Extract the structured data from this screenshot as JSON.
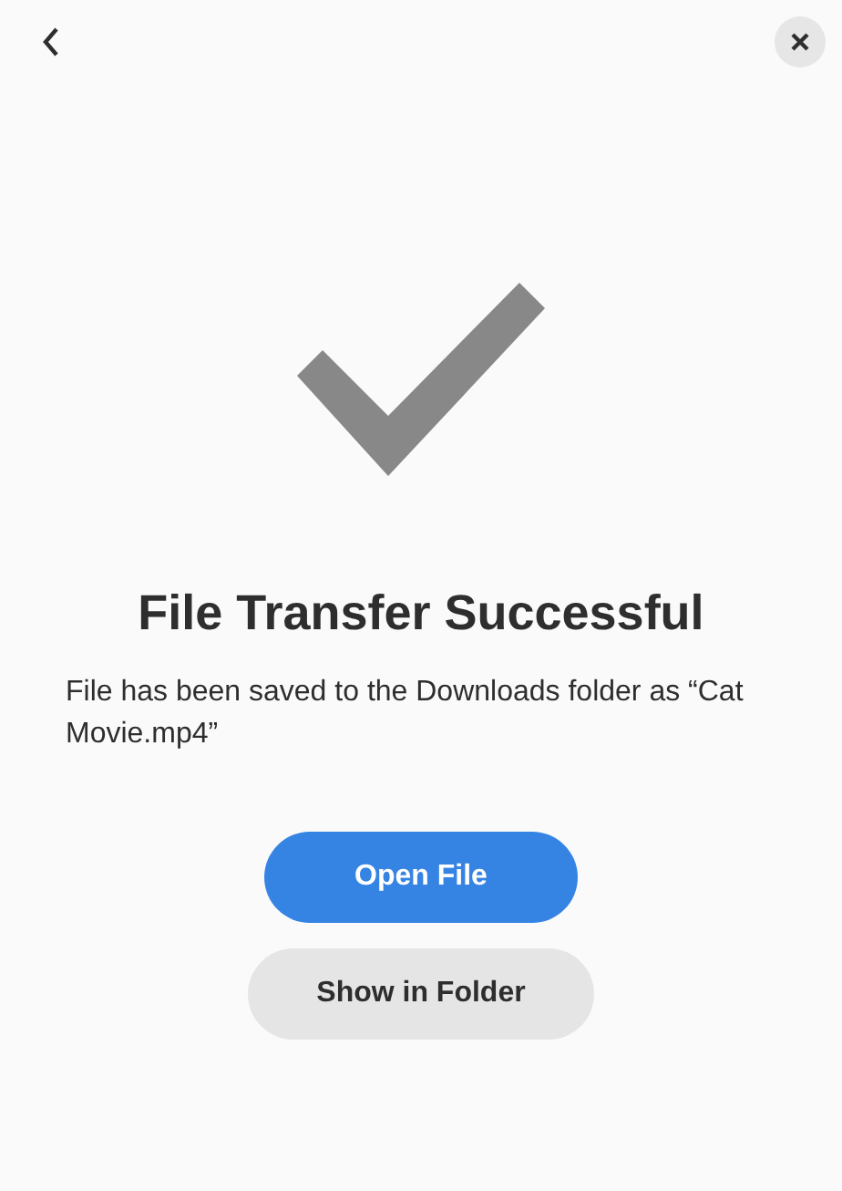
{
  "title": "File Transfer Successful",
  "message": "File has been saved to the Downloads folder as “Cat Movie.mp4”",
  "buttons": [
    {
      "label": "Open File",
      "kind": "primary"
    },
    {
      "label": "Show in Folder",
      "kind": "secondary"
    }
  ]
}
